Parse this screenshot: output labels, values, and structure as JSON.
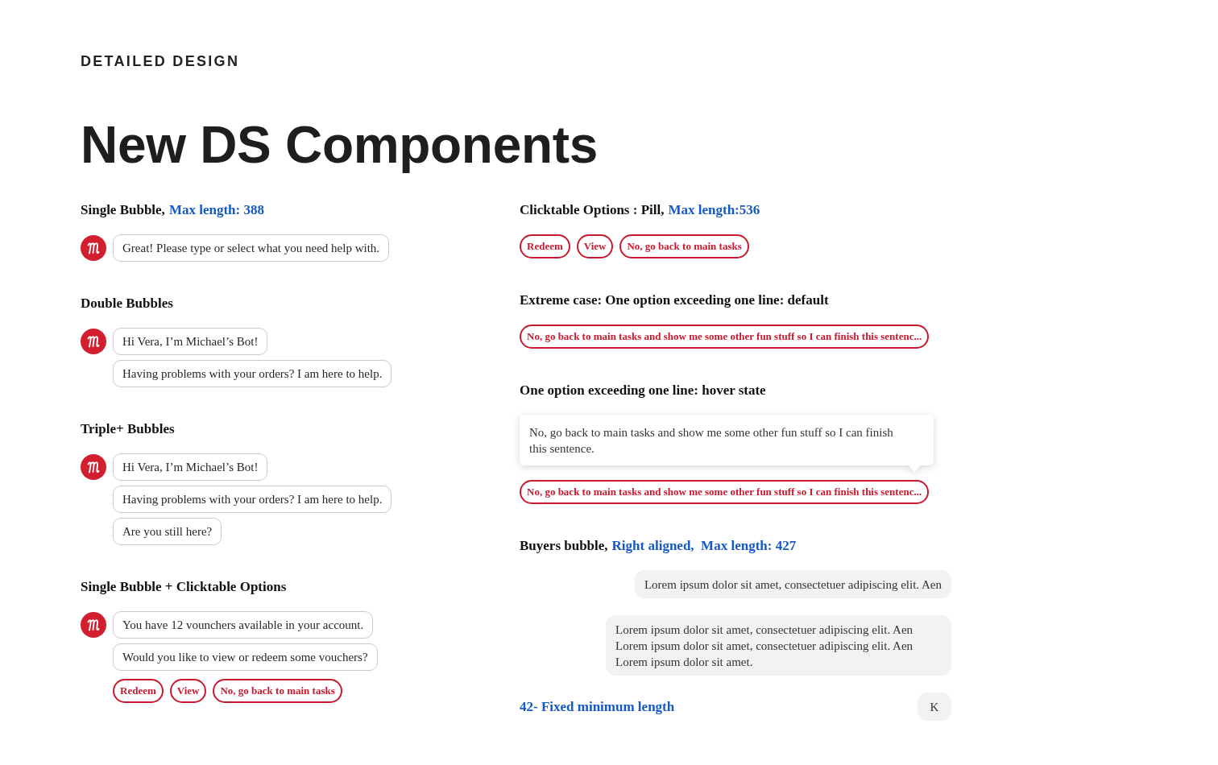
{
  "header": {
    "eyebrow": "DETAILED DESIGN",
    "title": "New DS Components"
  },
  "columns": [
    {
      "sections": [
        {
          "kind": "bot",
          "heading": "Single Bubble,",
          "note": "Max length: 388",
          "bubbles": [
            "Great! Please type or select what you need help with."
          ]
        },
        {
          "kind": "bot",
          "heading": "Double Bubbles",
          "bubbles": [
            "Hi Vera, I’m Michael’s Bot!",
            "Having problems with your orders? I am here to help."
          ]
        },
        {
          "kind": "bot",
          "heading": "Triple+ Bubbles",
          "bubbles": [
            "Hi Vera, I’m Michael’s Bot!",
            "Having problems with your orders? I am here to help.",
            "Are you still here?"
          ]
        },
        {
          "kind": "bot",
          "heading": "Single Bubble + Clicktable Options",
          "bubbles": [
            "You have 12 vounchers available in your account.",
            "Would you like to view or redeem some vouchers?"
          ],
          "options": [
            "Redeem",
            "View",
            "No, go back to main tasks"
          ]
        }
      ]
    },
    {
      "sections": [
        {
          "kind": "options",
          "heading": "Clicktable Options : Pill,",
          "note": "Max length:536",
          "options": [
            "Redeem",
            "View",
            "No, go back to main tasks"
          ]
        },
        {
          "kind": "options",
          "heading": "Extreme case: One option exceeding one line: default",
          "options": [
            "No, go back to main tasks and show me some other fun stuff so I can finish this sentenc..."
          ]
        },
        {
          "kind": "hover",
          "heading": "One option exceeding one line: hover state",
          "tooltip": "No, go back to main tasks and show me some other fun stuff so I can finish this sentence.",
          "options": [
            "No, go back to main tasks and show me some other fun stuff so I can finish this sentenc..."
          ]
        },
        {
          "kind": "buyer",
          "heading": "Buyers bubble,",
          "note": "Right aligned,  Max length: 427",
          "bubbles": [
            "Lorem ipsum dolor sit amet, consectetuer adipiscing elit. Aen",
            "Lorem ipsum dolor sit amet, consectetuer adipiscing elit. Aen Lorem ipsum dolor sit amet, consectetuer adipiscing elit. Aen Lorem ipsum dolor sit amet."
          ]
        },
        {
          "kind": "fixed",
          "note": "42- Fixed minimum length",
          "bubbles": [
            "K"
          ]
        }
      ]
    }
  ]
}
